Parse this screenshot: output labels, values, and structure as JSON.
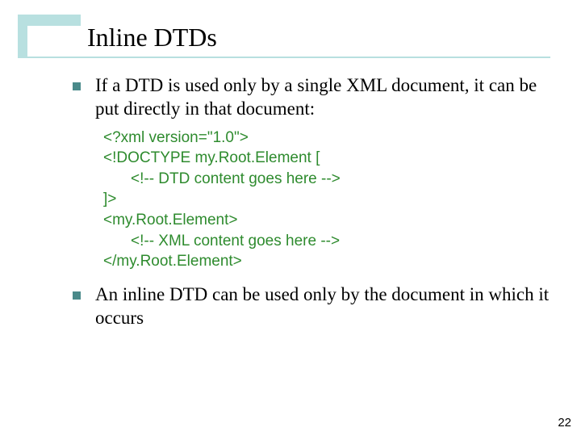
{
  "title": "Inline DTDs",
  "bullets": [
    "If a DTD is used only by a single XML document, it can be put directly in that document:",
    "An inline DTD can be used only by the document in which it occurs"
  ],
  "code": {
    "l1": "<?xml version=\"1.0\">",
    "l2": "<!DOCTYPE my.Root.Element [",
    "l3": "<!-- DTD content goes here -->",
    "l4": "]>",
    "l5": "<my.Root.Element>",
    "l6": "<!-- XML content goes here -->",
    "l7": "</my.Root.Element>"
  },
  "page_number": "22"
}
